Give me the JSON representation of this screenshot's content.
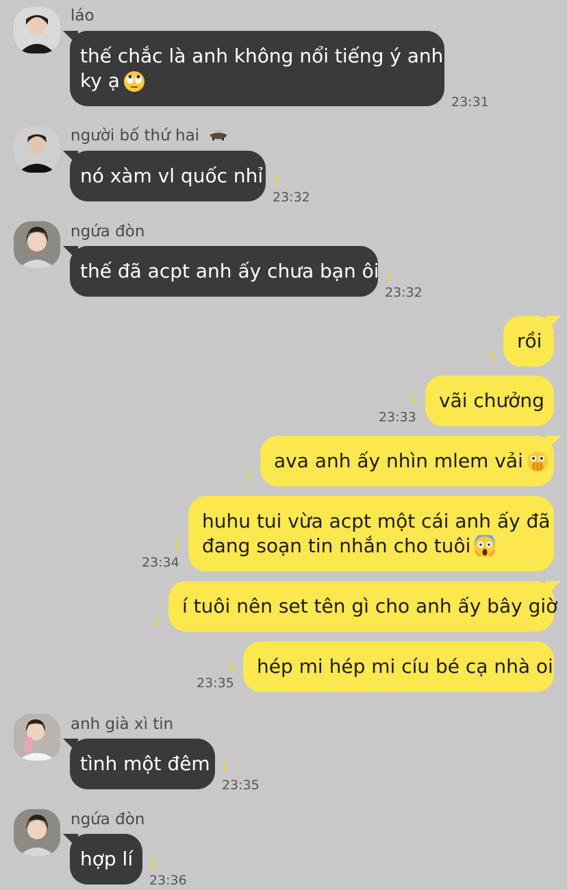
{
  "messages": [
    {
      "sender": "láo",
      "text": "thế chắc là anh không nổi tiếng ý anh",
      "text2": "ky ạ",
      "emoji": "face-with-rolling-eyes-icon",
      "time": "23:31"
    },
    {
      "sender": "người bố thứ hai",
      "sender_emoji": "badger-icon",
      "text": "nó xàm vl quốc nhỉ",
      "unread": "1",
      "time": "23:32"
    },
    {
      "sender": "ngứa đòn",
      "text": "thế đã acpt anh ấy chưa bạn ôi",
      "unread": "1",
      "time": "23:32"
    },
    {
      "text": "rồi",
      "unread": "1"
    },
    {
      "text": "vãi chưởng",
      "unread": "1",
      "time": "23:33"
    },
    {
      "text": "ava anh ấy nhìn mlem vải",
      "emoji": "face-with-open-eyes-and-hand-over-mouth-icon",
      "unread": "1"
    },
    {
      "text": "huhu tui vừa acpt một cái anh ấy đã",
      "text2": "đang soạn tin nhắn cho tuôi",
      "emoji": "face-screaming-in-fear-icon",
      "unread": "1",
      "time": "23:34"
    },
    {
      "text": "í tuôi nên set tên gì cho anh ấy bây giờ",
      "unread": "1"
    },
    {
      "text": "hép mi hép mi cíu bé cạ nhà oi",
      "unread": "1",
      "time": "23:35"
    },
    {
      "sender": "anh già xì tin",
      "text": "tình một đêm",
      "unread": "1",
      "time": "23:35"
    },
    {
      "sender": "ngứa đòn",
      "text": "hợp lí",
      "unread": "1",
      "time": "23:36"
    }
  ],
  "colors": {
    "background": "#c8c8c8",
    "incoming_bubble": "#3a3a3c",
    "outgoing_bubble": "#fbe74e",
    "unread": "#f2d21e"
  }
}
